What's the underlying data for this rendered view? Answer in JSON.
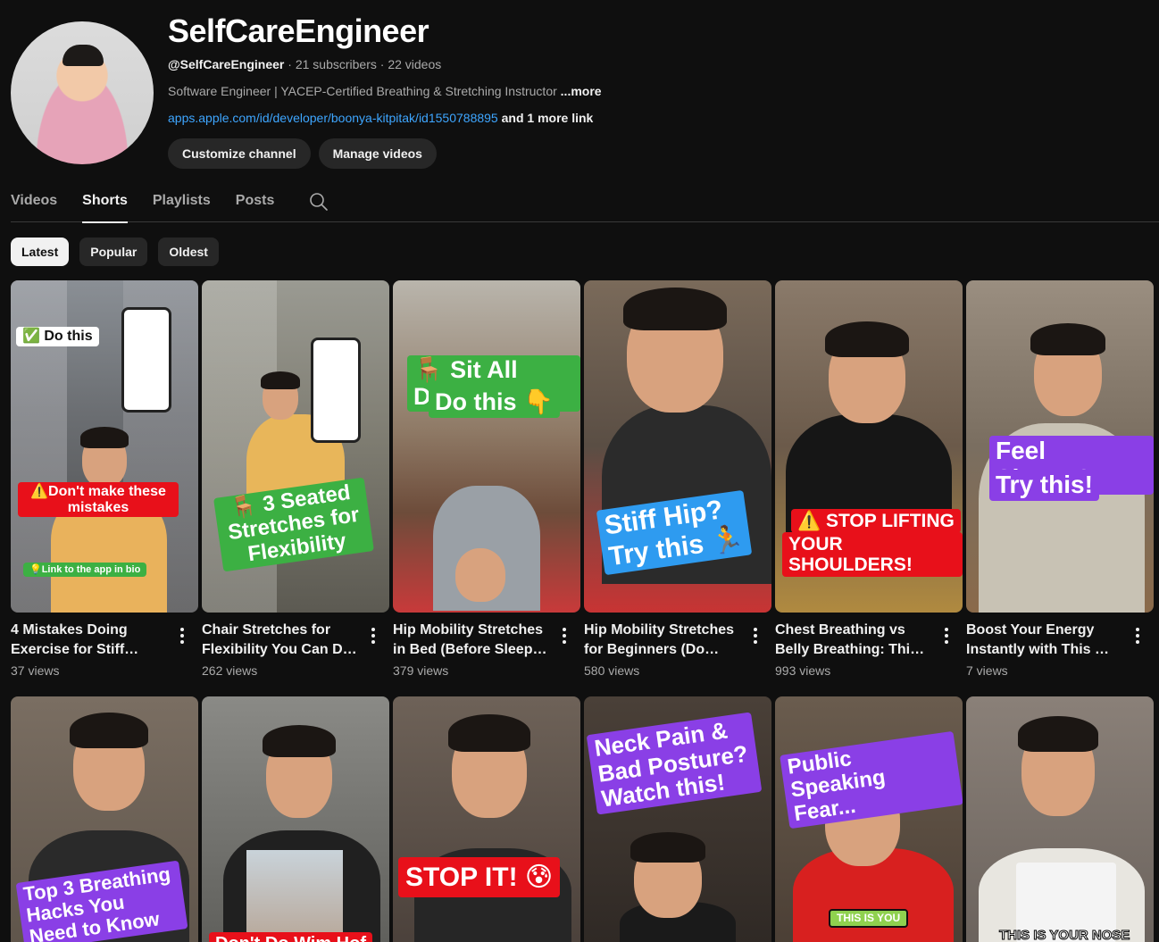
{
  "channel": {
    "name": "SelfCareEngineer",
    "handle": "@SelfCareEngineer",
    "subscribers": "21 subscribers",
    "videos_count": "22 videos",
    "separator": "·",
    "description": "Software Engineer | YACEP-Certified Breathing & Stretching Instructor ",
    "more_label": "...more",
    "link_url": "apps.apple.com/id/developer/boonya-kitpitak/id1550788895",
    "more_links": " and 1 more link"
  },
  "buttons": {
    "customize": "Customize channel",
    "manage": "Manage videos"
  },
  "tabs": [
    {
      "label": "Videos",
      "active": false
    },
    {
      "label": "Shorts",
      "active": true
    },
    {
      "label": "Playlists",
      "active": false
    },
    {
      "label": "Posts",
      "active": false
    }
  ],
  "chips": [
    {
      "label": "Latest",
      "active": true
    },
    {
      "label": "Popular",
      "active": false
    },
    {
      "label": "Oldest",
      "active": false
    }
  ],
  "shorts_row1": [
    {
      "title": "4 Mistakes Doing Exercise for Stiff Neck…",
      "views": "37 views",
      "overlays": [
        "✅ Do this",
        "⚠️Don't make these mistakes",
        "💡Link to the app in bio"
      ]
    },
    {
      "title": "Chair Stretches for Flexibility You Can Do …",
      "views": "262 views",
      "overlays": [
        "🪑 3 Seated Stretches for Flexibility"
      ]
    },
    {
      "title": "Hip Mobility Stretches in Bed (Before Sleep!) …",
      "views": "379 views",
      "overlays": [
        "🪑 Sit All Day?",
        "Do this 👇"
      ]
    },
    {
      "title": "Hip Mobility Stretches for Beginners (Do This…",
      "views": "580 views",
      "overlays": [
        "Stiff Hip?",
        "Try this 🏃"
      ]
    },
    {
      "title": "Chest Breathing vs Belly Breathing: This Mistak…",
      "views": "993 views",
      "overlays": [
        "⚠️ STOP LIFTING",
        "YOUR SHOULDERS!"
      ]
    },
    {
      "title": "Boost Your Energy Instantly with This …",
      "views": "7 views",
      "overlays": [
        "Feel Sleepy?",
        "Try this!"
      ]
    }
  ],
  "shorts_row2": [
    {
      "overlays": [
        "Top 3 Breathing Hacks You Need to Know"
      ]
    },
    {
      "overlays": [
        "Don't Do Wim Hof"
      ]
    },
    {
      "overlays": [
        "STOP IT! 😰"
      ]
    },
    {
      "overlays": [
        "Neck Pain & Bad Posture? Watch this!"
      ]
    },
    {
      "overlays": [
        "Public Speaking Fear...",
        "THIS IS YOU"
      ]
    },
    {
      "overlays": [
        "THIS IS YOUR NOSE"
      ]
    }
  ],
  "colors": {
    "background": "#0f0f0f",
    "link": "#3ea6ff",
    "chip": "#272727",
    "overlay_green": "#3cb043",
    "overlay_red": "#e8101a",
    "overlay_blue": "#2e9bf0",
    "overlay_purple": "#8a3fe6"
  },
  "icons": {
    "search": "search-icon",
    "more": "more-vert-icon"
  }
}
